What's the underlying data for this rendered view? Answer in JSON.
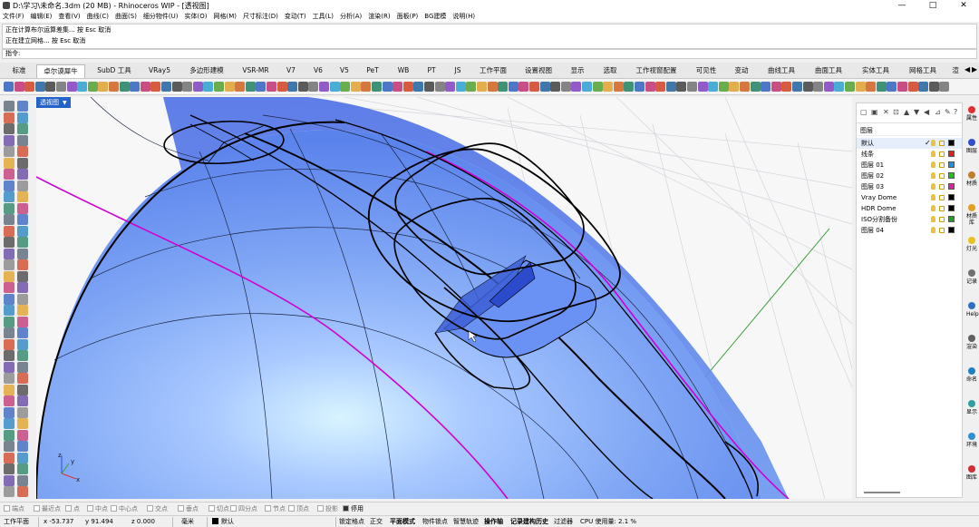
{
  "window": {
    "title": "D:\\学习\\未命名.3dm (20 MB) - Rhinoceros WIP - [透视图]",
    "controls": [
      "—",
      "□",
      "✕"
    ]
  },
  "menu": [
    "文件(F)",
    "编辑(E)",
    "查看(V)",
    "曲线(C)",
    "曲面(S)",
    "细分物件(U)",
    "实体(O)",
    "网格(M)",
    "尺寸标注(D)",
    "变动(T)",
    "工具(L)",
    "分析(A)",
    "渲染(R)",
    "面板(P)",
    "BG建模",
    "说明(H)"
  ],
  "command_history": [
    "正在计算布尔运算差集... 按 Esc 取消",
    "正在建立网格... 按 Esc 取消"
  ],
  "command_prompt": "指令:",
  "tabs": [
    "标准",
    "卓尔谟犀牛",
    "SubD 工具",
    "VRay5",
    "多边形建模",
    "VSR-MR",
    "V7",
    "V6",
    "V5",
    "PeT",
    "WB",
    "PT",
    "JS",
    "工作平面",
    "设置视图",
    "显示",
    "选取",
    "工作视窗配置",
    "可见性",
    "变动",
    "曲线工具",
    "曲面工具",
    "实体工具",
    "网格工具",
    "渲"
  ],
  "active_tab_index": 1,
  "viewport": {
    "label": "透视图",
    "dropdown_icon": "chevron-down-icon",
    "axis_labels": {
      "x": "x",
      "y": "y",
      "z": "z"
    },
    "colors": {
      "surface": "#6c97f0",
      "highlight": "#d8f4ff",
      "isocurve_magenta": "#d000d0",
      "grid_green": "#40a040"
    }
  },
  "layers_panel": {
    "header": "图层",
    "rows": [
      {
        "name": "默认",
        "current": true,
        "check": "✓",
        "color": "#000000"
      },
      {
        "name": "线条",
        "color": "#e02020"
      },
      {
        "name": "图层 01",
        "color": "#2090e0"
      },
      {
        "name": "图层 02",
        "color": "#20c020"
      },
      {
        "name": "图层 03",
        "color": "#e020a0"
      },
      {
        "name": "Vray Dome",
        "color": "#000000"
      },
      {
        "name": "HDR Dome",
        "color": "#000000"
      },
      {
        "name": "ISO分割备份",
        "color": "#20a020"
      },
      {
        "name": "图层 04",
        "color": "#000000"
      }
    ]
  },
  "right_panels": [
    "属性",
    "图层",
    "材质",
    "材质库",
    "灯光",
    "记录",
    "Help",
    "渲染",
    "命名",
    "显示",
    "环境",
    "图库"
  ],
  "osnaps": [
    {
      "label": "端点",
      "checked": false
    },
    {
      "label": "最近点",
      "checked": false
    },
    {
      "label": "点",
      "checked": false
    },
    {
      "label": "中点",
      "checked": false
    },
    {
      "label": "中心点",
      "checked": false
    },
    {
      "label": "交点",
      "checked": false
    },
    {
      "label": "垂点",
      "checked": false
    },
    {
      "label": "切点",
      "checked": false
    },
    {
      "label": "四分点",
      "checked": false
    },
    {
      "label": "节点",
      "checked": false
    },
    {
      "label": "顶点",
      "checked": false
    },
    {
      "label": "投影",
      "checked": false
    },
    {
      "label": "停用",
      "checked": true
    }
  ],
  "status": {
    "cplane": "工作平面",
    "x": "x -53.737",
    "y": "y 91.494",
    "z": "z 0.000",
    "unit": "毫米",
    "layer": "默认",
    "layer_color": "#000000",
    "toggles": [
      "锁定格点",
      "正交",
      "平面模式",
      "物件锁点",
      "智慧轨迹",
      "操作轴",
      "记录建构历史",
      "过滤器"
    ],
    "bold_toggles": [
      "平面模式",
      "操作轴",
      "记录建构历史"
    ],
    "cpu": "CPU 使用量: 2.1 %"
  }
}
